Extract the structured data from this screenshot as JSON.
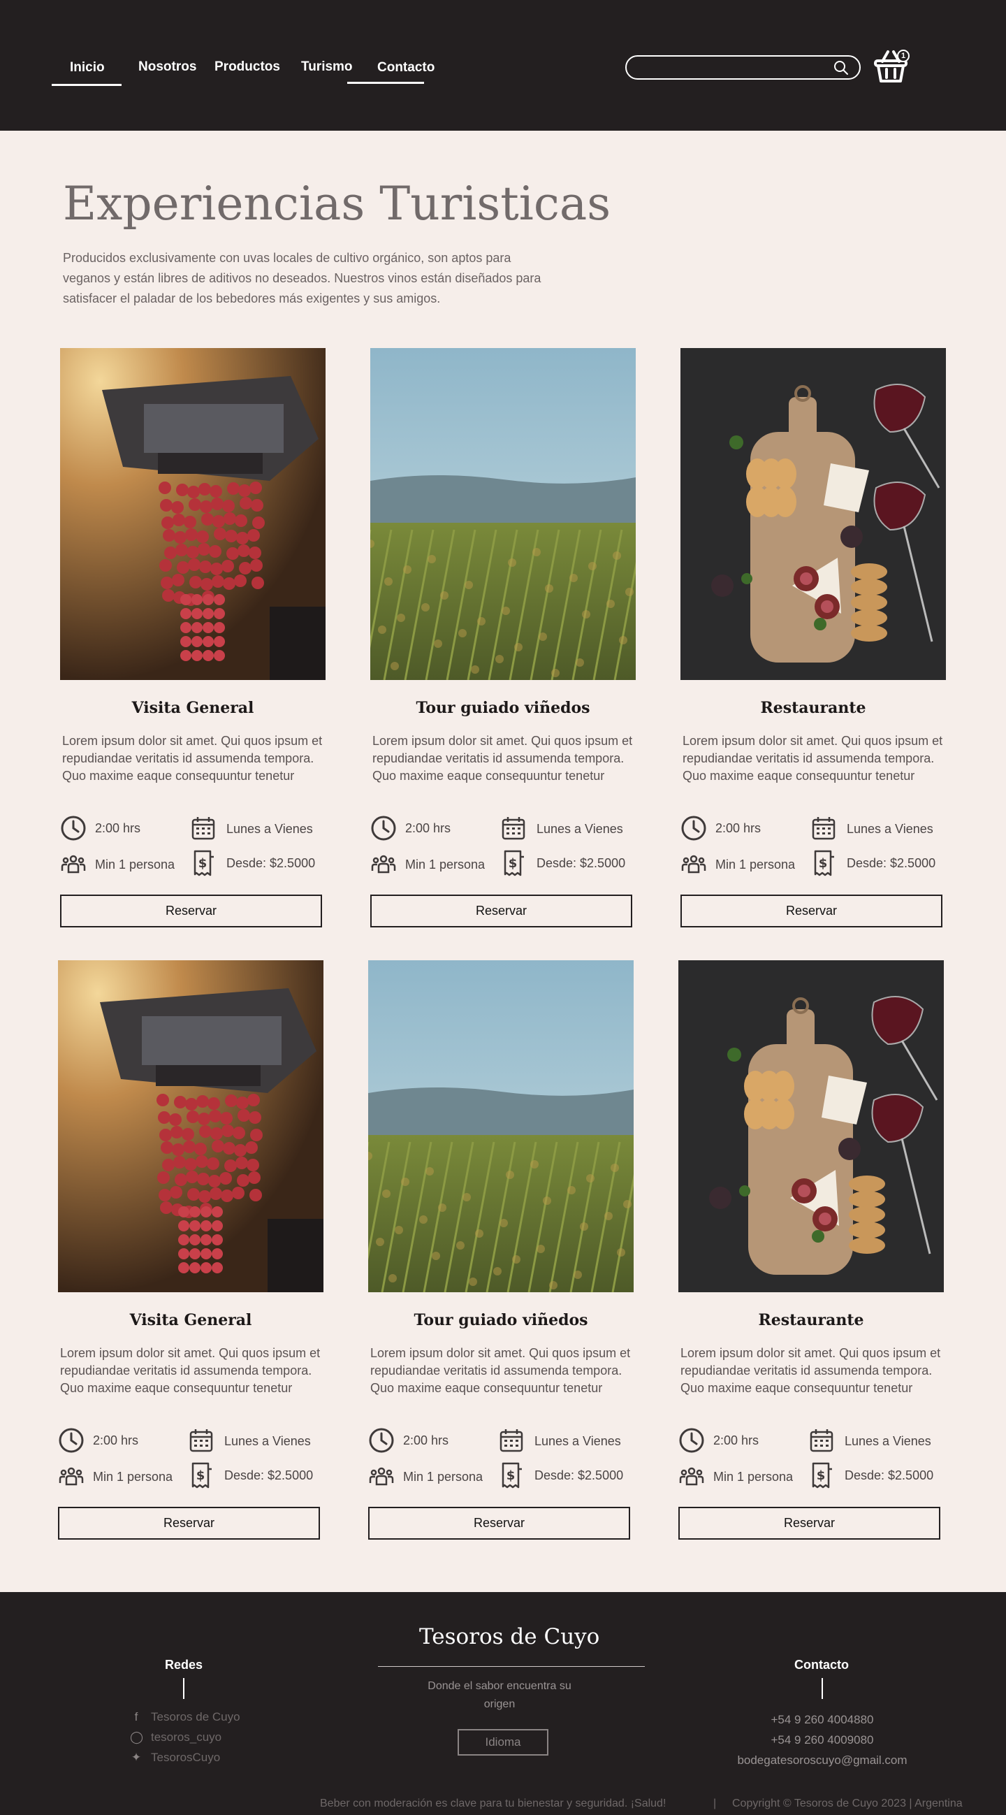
{
  "nav": {
    "items": [
      "Inicio",
      "Nosotros",
      "Productos",
      "Turismo",
      "Contacto"
    ],
    "active": "Inicio"
  },
  "search": {
    "placeholder": "",
    "icon": "search-icon"
  },
  "cart": {
    "count": "1",
    "icon": "basket-icon"
  },
  "intro": {
    "title": "Experiencias Turisticas",
    "text": "Producidos exclusivamente con uvas locales de cultivo orgánico, son aptos para veganos y están libres de aditivos no deseados. Nuestros vinos están diseñados para satisfacer el paladar de los bebedores más exigentes y sus amigos."
  },
  "cards": [
    {
      "title": "Visita General",
      "image": "grapes-harvest",
      "desc": "Lorem ipsum dolor sit amet. Qui quos ipsum et repudiandae veritatis id assumenda tempora. Quo maxime eaque consequuntur tenetur",
      "duration": "2:00 hrs",
      "days": "Lunes a Vienes",
      "min": "Min 1 persona",
      "price": "Desde: $2.5000",
      "button": "Reservar"
    },
    {
      "title": "Tour guiado viñedos",
      "image": "vineyard-landscape",
      "desc": "Lorem ipsum dolor sit amet. Qui quos ipsum et repudiandae veritatis id assumenda tempora. Quo maxime eaque consequuntur tenetur",
      "duration": "2:00 hrs",
      "days": "Lunes a Vienes",
      "min": "Min 1 persona",
      "price": "Desde: $2.5000",
      "button": "Reservar"
    },
    {
      "title": "Restaurante",
      "image": "cheese-board",
      "desc": "Lorem ipsum dolor sit amet. Qui quos ipsum et repudiandae veritatis id assumenda tempora. Quo maxime eaque consequuntur tenetur",
      "duration": "2:00 hrs",
      "days": "Lunes a Vienes",
      "min": "Min 1 persona",
      "price": "Desde: $2.5000",
      "button": "Reservar"
    },
    {
      "title": "Visita General",
      "image": "grapes-harvest",
      "desc": "Lorem ipsum dolor sit amet. Qui quos ipsum et repudiandae veritatis id assumenda tempora. Quo maxime eaque consequuntur tenetur",
      "duration": "2:00 hrs",
      "days": "Lunes a Vienes",
      "min": "Min 1 persona",
      "price": "Desde: $2.5000",
      "button": "Reservar"
    },
    {
      "title": "Tour guiado viñedos",
      "image": "vineyard-landscape",
      "desc": "Lorem ipsum dolor sit amet. Qui quos ipsum et repudiandae veritatis id assumenda tempora. Quo maxime eaque consequuntur tenetur",
      "duration": "2:00 hrs",
      "days": "Lunes a Vienes",
      "min": "Min 1 persona",
      "price": "Desde: $2.5000",
      "button": "Reservar"
    },
    {
      "title": "Restaurante",
      "image": "cheese-board",
      "desc": "Lorem ipsum dolor sit amet. Qui quos ipsum et repudiandae veritatis id assumenda tempora. Quo maxime eaque consequuntur tenetur",
      "duration": "2:00 hrs",
      "days": "Lunes a Vienes",
      "min": "Min 1 persona",
      "price": "Desde: $2.5000",
      "button": "Reservar"
    }
  ],
  "footer": {
    "redes": {
      "title": "Redes",
      "items": [
        {
          "icon": "facebook-icon",
          "label": "Tesoros de Cuyo"
        },
        {
          "icon": "instagram-icon",
          "label": "tesoros_cuyo"
        },
        {
          "icon": "twitter-icon",
          "label": "TesorosCuyo"
        }
      ]
    },
    "brand": "Tesoros de Cuyo",
    "tagline": "Donde el sabor encuentra su origen",
    "language_button": "Idioma",
    "contacto": {
      "title": "Contacto",
      "items": [
        "+54 9 260 4004880",
        "+54 9 260 4009080",
        "bodegatesoroscuyo@gmail.com"
      ]
    },
    "disclaimer": "Beber con moderación es clave para tu bienestar y seguridad. ¡Salud!",
    "separator": "|",
    "copyright": "Copyright © Tesoros de Cuyo  2023 | Argentina"
  },
  "colors": {
    "dark": "#231f20",
    "background": "#f6eeea",
    "text": "#4a4444"
  }
}
